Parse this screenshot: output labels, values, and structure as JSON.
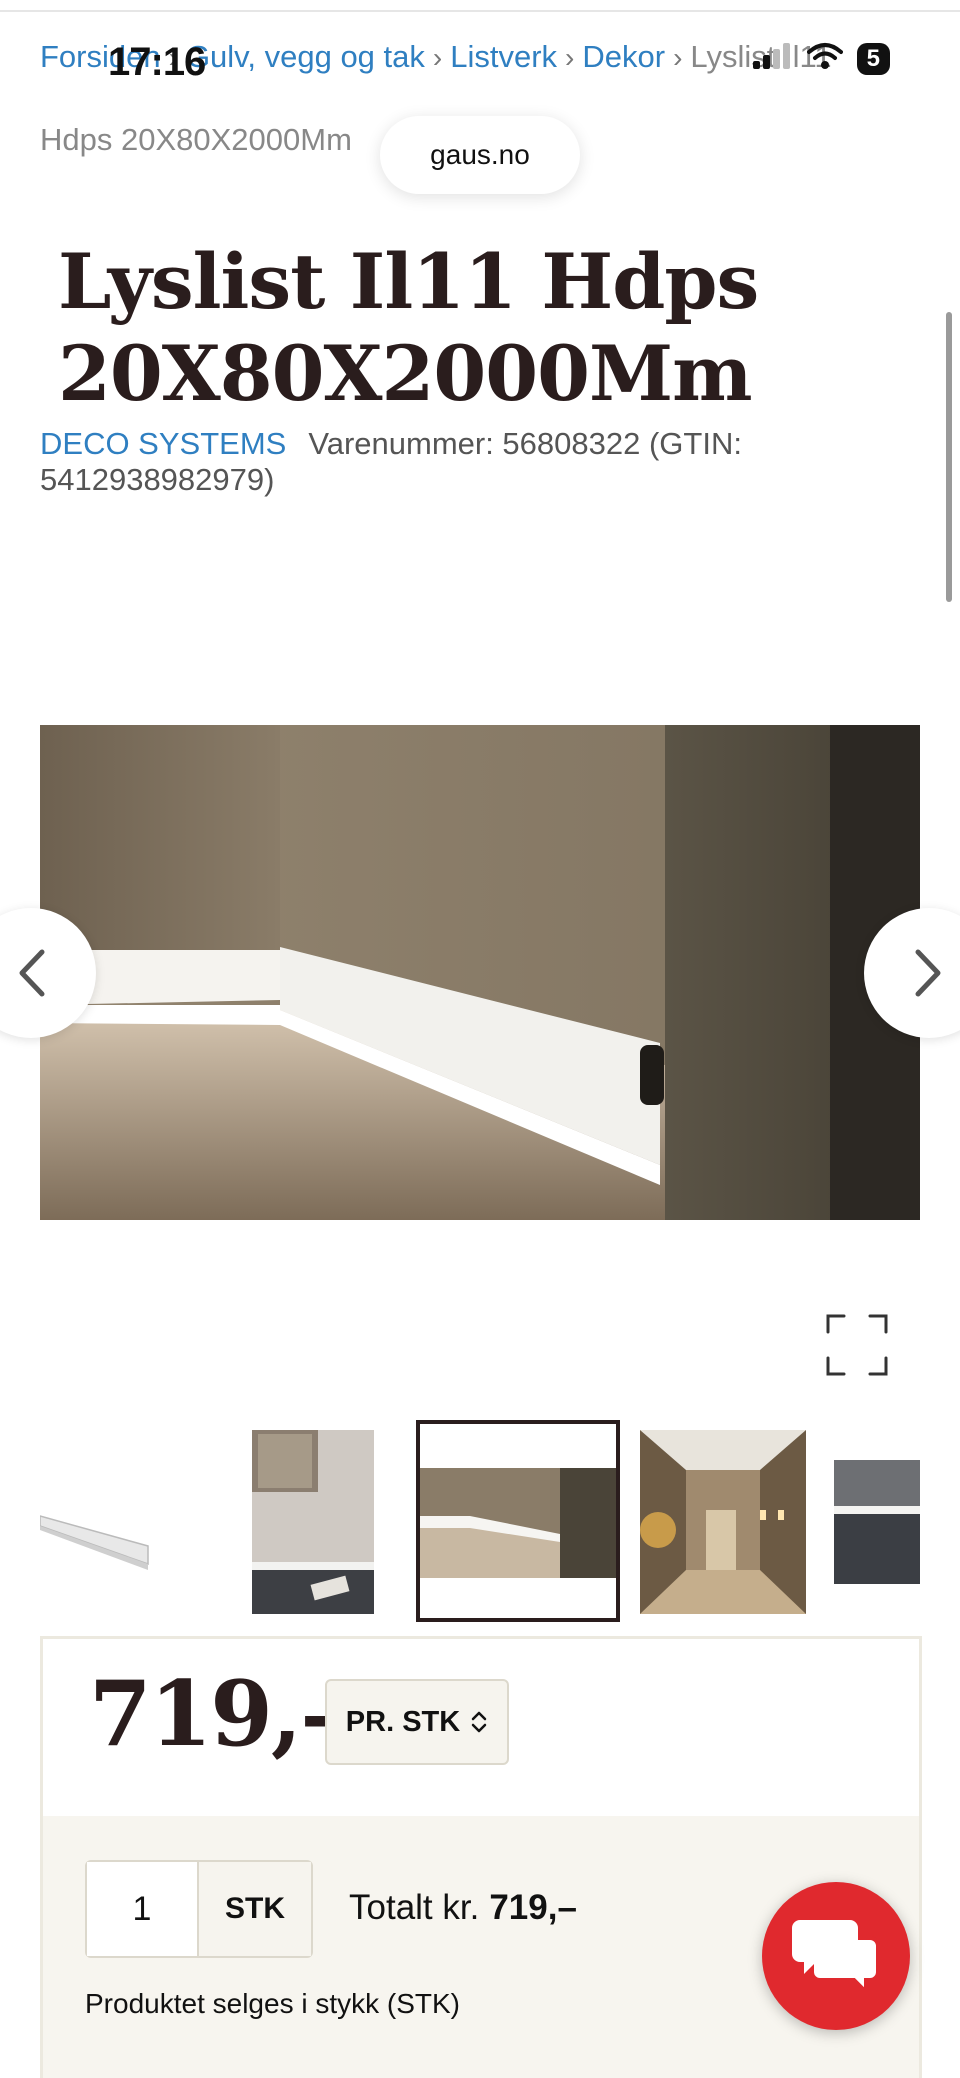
{
  "status": {
    "time": "17:16",
    "battery": "5"
  },
  "browser": {
    "url": "gaus.no"
  },
  "breadcrumb": {
    "items": [
      "Forsiden",
      "Gulv, vegg og tak",
      "Listverk",
      "Dekor"
    ],
    "current_line1": "Lyslist Il11",
    "current_line2": "Hdps 20X80X2000Mm",
    "separator": "›"
  },
  "product": {
    "title": "Lyslist Il11 Hdps 20X80X2000Mm",
    "brand": "DECO SYSTEMS",
    "sku_text": "Varenummer: 56808322 (GTIN: 5412938982979)"
  },
  "gallery": {
    "selected_index": 2,
    "thumbnail_count": 5
  },
  "price": {
    "amount": "719,–",
    "unit_select": "PR. STK"
  },
  "quantity": {
    "value": "1",
    "unit": "STK",
    "total_label": "Totalt kr.",
    "total_value": "719,–",
    "note": "Produktet selges i stykk (STK)"
  },
  "colors": {
    "link": "#2f7fc1",
    "title": "#2a1d1d",
    "chat": "#e0292e",
    "panel": "#f7f5ef"
  },
  "icons": [
    "chevron-left-icon",
    "chevron-right-icon",
    "expand-icon",
    "chevron-updown-icon",
    "chat-icon",
    "signal-icon",
    "wifi-icon"
  ]
}
